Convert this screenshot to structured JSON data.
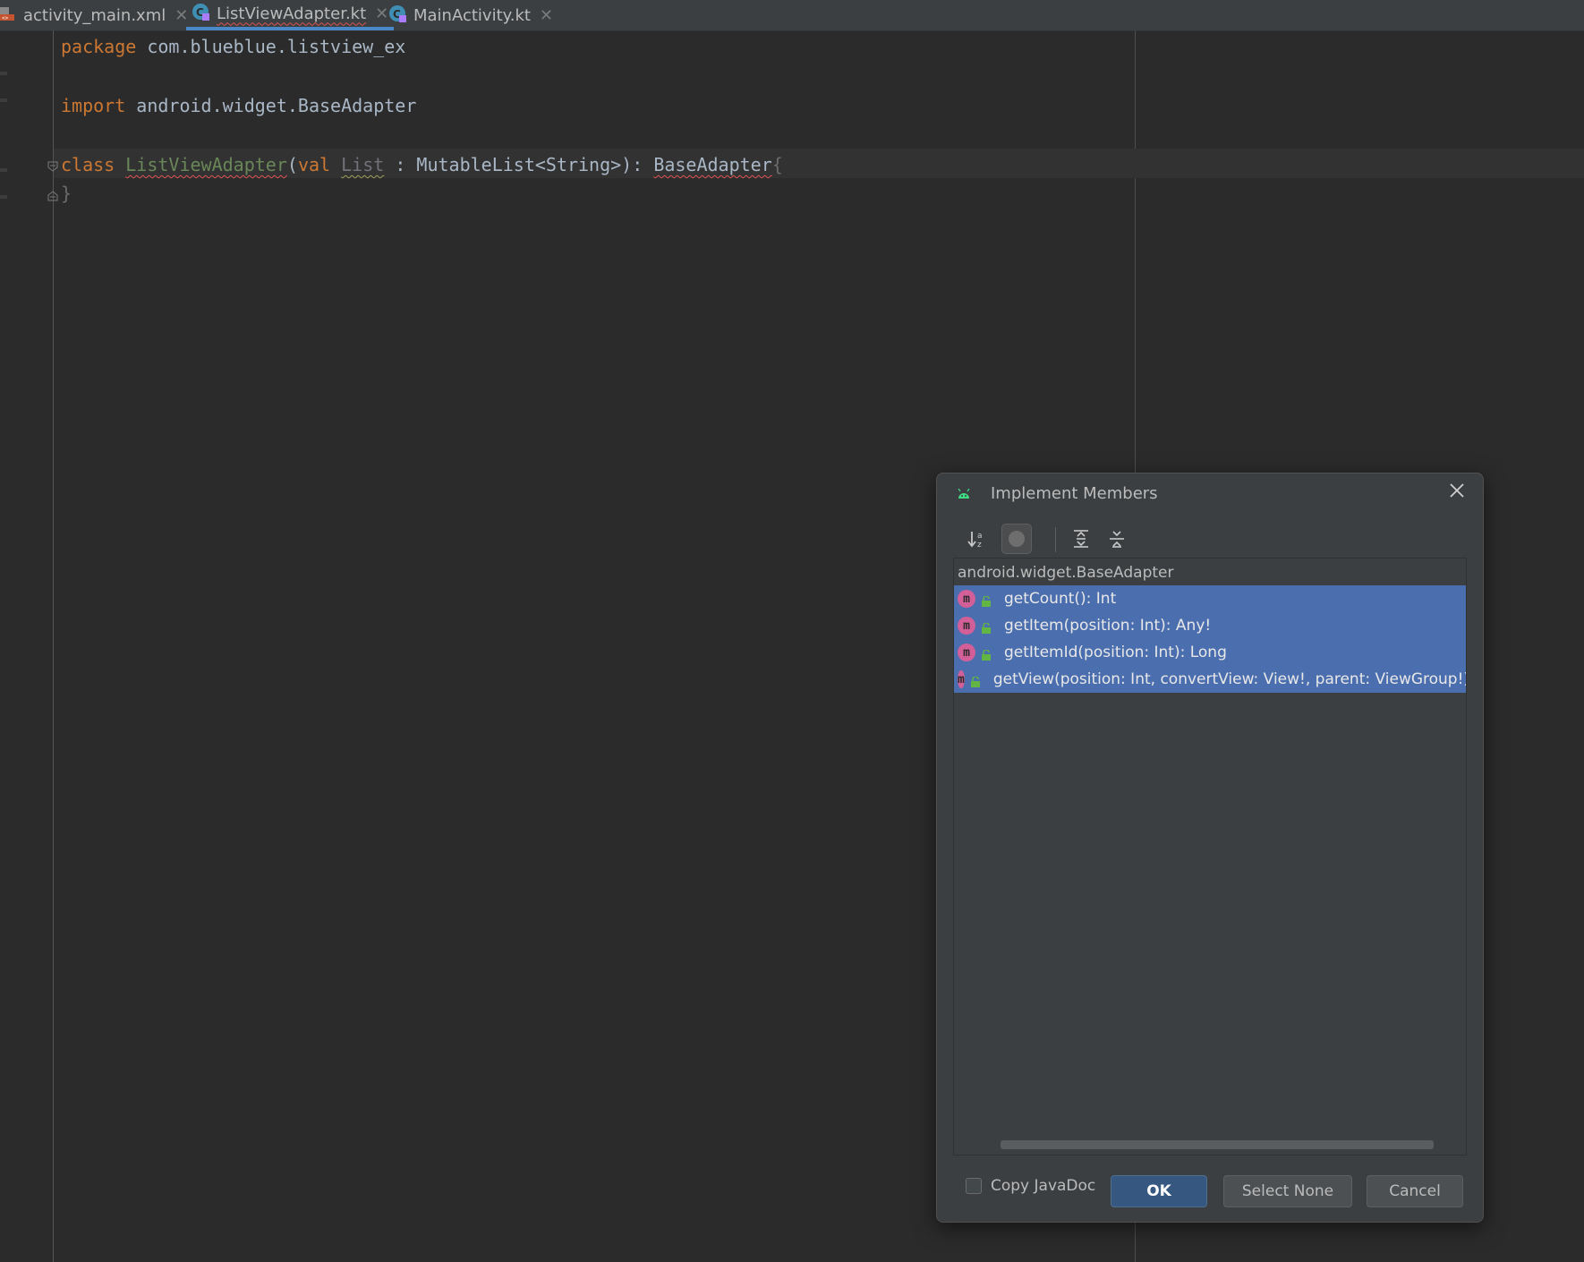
{
  "tabs": [
    {
      "label": "activity_main.xml",
      "icon": "xml-file-icon",
      "active": false
    },
    {
      "label": "ListViewAdapter.kt",
      "icon": "kotlin-class-icon",
      "active": true
    },
    {
      "label": "MainActivity.kt",
      "icon": "kotlin-class-icon",
      "active": false
    }
  ],
  "editor": {
    "line1": {
      "kw": "package",
      "rest": " com.blueblue.listview_ex"
    },
    "line3": {
      "kw": "import",
      "rest": " android.widget.BaseAdapter"
    },
    "line5": {
      "kw_class": "class",
      "class_name": "ListViewAdapter",
      "open_paren": "(",
      "kw_val": "val",
      "param": "List",
      "type_part": " : MutableList<String>): ",
      "base": "BaseAdapter",
      "brace": "{"
    },
    "line6": {
      "brace": "}"
    }
  },
  "dialog": {
    "title": "Implement Members",
    "toolbar": [
      "sort-alpha-icon",
      "show-classes-icon",
      "expand-all-icon",
      "collapse-all-icon"
    ],
    "tree_root": "android.widget.BaseAdapter",
    "members": [
      "getCount(): Int",
      "getItem(position: Int): Any!",
      "getItemId(position: Int): Long",
      "getView(position: Int, convertView: View!, parent: ViewGroup!): View"
    ],
    "copy_javadoc_label": "Copy JavaDoc",
    "copy_javadoc_checked": false,
    "ok_label": "OK",
    "select_none_label": "Select None",
    "cancel_label": "Cancel"
  },
  "colors": {
    "editor_bg": "#2b2b2b",
    "keyword": "#cc7832",
    "selection": "#4b6eaf",
    "ok_button": "#365880"
  }
}
